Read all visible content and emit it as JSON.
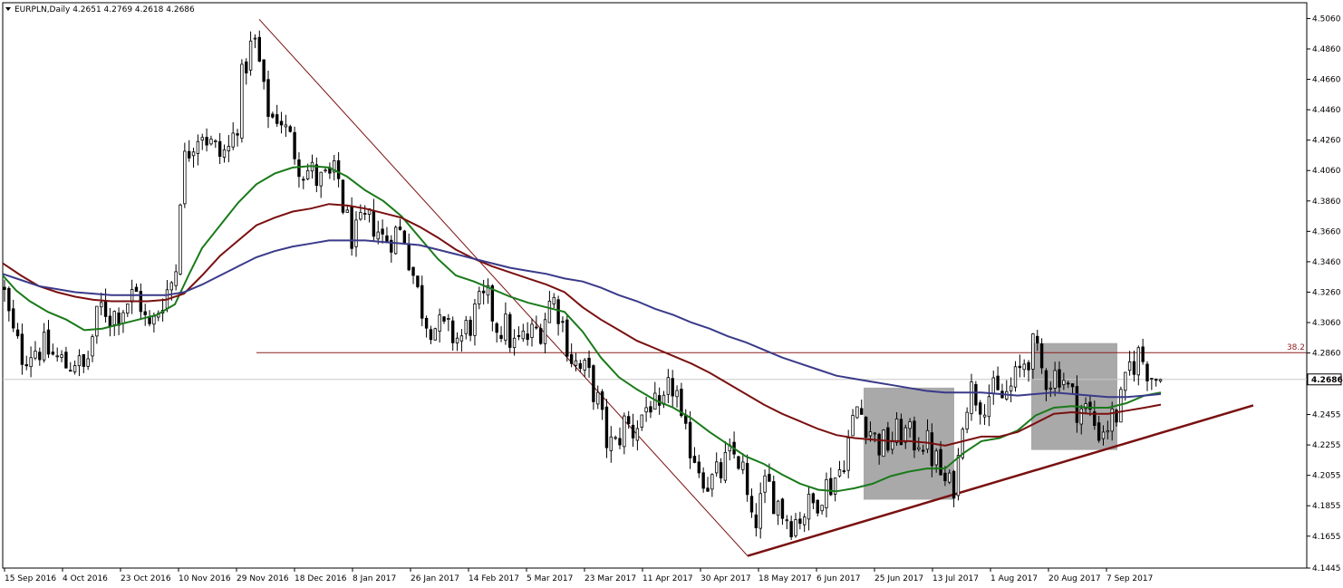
{
  "chart_data": {
    "type": "candlestick",
    "title": "EURPLN,Daily",
    "ohlc": {
      "open": "4.2651",
      "high": "4.2769",
      "low": "4.2618",
      "close": "4.2686"
    },
    "current_price_label": "4.2686",
    "current_price": 4.2686,
    "ylim": [
      4.1445,
      4.5164
    ],
    "y_ticks": [
      "4.5060",
      "4.4860",
      "4.4660",
      "4.4460",
      "4.4260",
      "4.4060",
      "4.3860",
      "4.3660",
      "4.3460",
      "4.3260",
      "4.3060",
      "4.2860",
      "4.2455",
      "4.2255",
      "4.2055",
      "4.1855",
      "4.1655",
      "4.1445"
    ],
    "x_labels": [
      "15 Sep 2016",
      "4 Oct 2016",
      "23 Oct 2016",
      "10 Nov 2016",
      "29 Nov 2016",
      "18 Dec 2016",
      "8 Jan 2017",
      "26 Jan 2017",
      "14 Feb 2017",
      "5 Mar 2017",
      "23 Mar 2017",
      "11 Apr 2017",
      "30 Apr 2017",
      "18 May 2017",
      "6 Jun 2017",
      "25 Jun 2017",
      "13 Jul 2017",
      "1 Aug 2017",
      "20 Aug 2017",
      "7 Sep 2017"
    ],
    "price_path": [
      [
        0,
        4.33
      ],
      [
        10,
        4.3
      ],
      [
        20,
        4.285
      ],
      [
        30,
        4.288
      ],
      [
        40,
        4.29
      ],
      [
        50,
        4.287
      ],
      [
        60,
        4.282
      ],
      [
        70,
        4.278
      ],
      [
        80,
        4.283
      ],
      [
        88,
        4.272
      ],
      [
        95,
        4.285
      ],
      [
        100,
        4.3
      ],
      [
        110,
        4.318
      ],
      [
        120,
        4.31
      ],
      [
        130,
        4.315
      ],
      [
        140,
        4.322
      ],
      [
        150,
        4.325
      ],
      [
        160,
        4.3
      ],
      [
        165,
        4.302
      ],
      [
        175,
        4.322
      ],
      [
        185,
        4.33
      ],
      [
        192,
        4.345
      ],
      [
        197,
        4.405
      ],
      [
        205,
        4.42
      ],
      [
        212,
        4.43
      ],
      [
        220,
        4.434
      ],
      [
        230,
        4.422
      ],
      [
        240,
        4.416
      ],
      [
        250,
        4.42
      ],
      [
        258,
        4.435
      ],
      [
        265,
        4.47
      ],
      [
        272,
        4.485
      ],
      [
        280,
        4.49
      ],
      [
        288,
        4.455
      ],
      [
        297,
        4.44
      ],
      [
        305,
        4.445
      ],
      [
        313,
        4.43
      ],
      [
        322,
        4.42
      ],
      [
        330,
        4.408
      ],
      [
        340,
        4.405
      ],
      [
        350,
        4.398
      ],
      [
        360,
        4.4
      ],
      [
        370,
        4.402
      ],
      [
        378,
        4.375
      ],
      [
        388,
        4.36
      ],
      [
        398,
        4.37
      ],
      [
        410,
        4.372
      ],
      [
        420,
        4.36
      ],
      [
        432,
        4.365
      ],
      [
        443,
        4.365
      ],
      [
        450,
        4.345
      ],
      [
        458,
        4.325
      ],
      [
        466,
        4.31
      ],
      [
        475,
        4.305
      ],
      [
        485,
        4.3
      ],
      [
        495,
        4.298
      ],
      [
        505,
        4.295
      ],
      [
        515,
        4.305
      ],
      [
        525,
        4.315
      ],
      [
        535,
        4.32
      ],
      [
        545,
        4.305
      ],
      [
        555,
        4.302
      ],
      [
        565,
        4.29
      ],
      [
        575,
        4.295
      ],
      [
        585,
        4.298
      ],
      [
        595,
        4.305
      ],
      [
        605,
        4.322
      ],
      [
        612,
        4.318
      ],
      [
        620,
        4.3
      ],
      [
        628,
        4.283
      ],
      [
        636,
        4.275
      ],
      [
        645,
        4.272
      ],
      [
        655,
        4.258
      ],
      [
        665,
        4.23
      ],
      [
        675,
        4.222
      ],
      [
        685,
        4.24
      ],
      [
        695,
        4.235
      ],
      [
        705,
        4.245
      ],
      [
        715,
        4.255
      ],
      [
        725,
        4.24
      ],
      [
        735,
        4.26
      ],
      [
        742,
        4.268
      ],
      [
        750,
        4.23
      ],
      [
        760,
        4.225
      ],
      [
        770,
        4.21
      ],
      [
        780,
        4.2
      ],
      [
        790,
        4.205
      ],
      [
        800,
        4.215
      ],
      [
        810,
        4.22
      ],
      [
        818,
        4.205
      ],
      [
        826,
        4.17
      ],
      [
        833,
        4.18
      ],
      [
        843,
        4.2
      ],
      [
        853,
        4.19
      ],
      [
        863,
        4.18
      ],
      [
        873,
        4.175
      ],
      [
        883,
        4.182
      ],
      [
        893,
        4.185
      ],
      [
        903,
        4.196
      ],
      [
        913,
        4.2
      ],
      [
        923,
        4.208
      ],
      [
        933,
        4.228
      ],
      [
        943,
        4.25
      ],
      [
        953,
        4.242
      ],
      [
        963,
        4.228
      ],
      [
        973,
        4.225
      ],
      [
        983,
        4.23
      ],
      [
        993,
        4.235
      ],
      [
        1003,
        4.228
      ],
      [
        1013,
        4.232
      ],
      [
        1023,
        4.222
      ],
      [
        1033,
        4.21
      ],
      [
        1043,
        4.195
      ],
      [
        1053,
        4.205
      ],
      [
        1060,
        4.252
      ],
      [
        1070,
        4.262
      ],
      [
        1080,
        4.255
      ],
      [
        1090,
        4.26
      ],
      [
        1100,
        4.255
      ],
      [
        1110,
        4.26
      ],
      [
        1120,
        4.27
      ],
      [
        1130,
        4.285
      ],
      [
        1138,
        4.288
      ],
      [
        1148,
        4.272
      ],
      [
        1158,
        4.27
      ],
      [
        1168,
        4.275
      ],
      [
        1178,
        4.258
      ],
      [
        1188,
        4.25
      ],
      [
        1198,
        4.248
      ],
      [
        1208,
        4.235
      ],
      [
        1218,
        4.238
      ],
      [
        1228,
        4.245
      ],
      [
        1236,
        4.255
      ],
      [
        1244,
        4.278
      ],
      [
        1254,
        4.285
      ],
      [
        1262,
        4.278
      ],
      [
        1270,
        4.27
      ],
      [
        1278,
        4.2686
      ]
    ],
    "series": [
      {
        "color": "#1a7a1a",
        "values": [
          [
            0,
            4.337
          ],
          [
            15,
            4.327
          ],
          [
            30,
            4.32
          ],
          [
            50,
            4.313
          ],
          [
            70,
            4.308
          ],
          [
            90,
            4.301
          ],
          [
            110,
            4.302
          ],
          [
            130,
            4.305
          ],
          [
            150,
            4.308
          ],
          [
            170,
            4.311
          ],
          [
            190,
            4.318
          ],
          [
            205,
            4.337
          ],
          [
            220,
            4.355
          ],
          [
            240,
            4.37
          ],
          [
            260,
            4.385
          ],
          [
            280,
            4.397
          ],
          [
            300,
            4.404
          ],
          [
            320,
            4.408
          ],
          [
            340,
            4.409
          ],
          [
            360,
            4.408
          ],
          [
            380,
            4.402
          ],
          [
            400,
            4.393
          ],
          [
            420,
            4.386
          ],
          [
            440,
            4.376
          ],
          [
            460,
            4.362
          ],
          [
            480,
            4.348
          ],
          [
            500,
            4.337
          ],
          [
            520,
            4.333
          ],
          [
            540,
            4.328
          ],
          [
            560,
            4.323
          ],
          [
            580,
            4.319
          ],
          [
            600,
            4.316
          ],
          [
            620,
            4.313
          ],
          [
            640,
            4.3
          ],
          [
            660,
            4.283
          ],
          [
            680,
            4.27
          ],
          [
            700,
            4.262
          ],
          [
            720,
            4.255
          ],
          [
            740,
            4.25
          ],
          [
            760,
            4.243
          ],
          [
            780,
            4.234
          ],
          [
            800,
            4.226
          ],
          [
            820,
            4.218
          ],
          [
            840,
            4.213
          ],
          [
            860,
            4.206
          ],
          [
            880,
            4.2
          ],
          [
            900,
            4.196
          ],
          [
            920,
            4.195
          ],
          [
            940,
            4.197
          ],
          [
            960,
            4.2
          ],
          [
            980,
            4.205
          ],
          [
            1000,
            4.208
          ],
          [
            1020,
            4.21
          ],
          [
            1040,
            4.21
          ],
          [
            1060,
            4.22
          ],
          [
            1080,
            4.228
          ],
          [
            1100,
            4.23
          ],
          [
            1120,
            4.235
          ],
          [
            1140,
            4.245
          ],
          [
            1160,
            4.25
          ],
          [
            1180,
            4.251
          ],
          [
            1200,
            4.25
          ],
          [
            1220,
            4.25
          ],
          [
            1240,
            4.253
          ],
          [
            1260,
            4.258
          ],
          [
            1278,
            4.26
          ]
        ]
      },
      {
        "color": "#7a1010",
        "values": [
          [
            0,
            4.345
          ],
          [
            20,
            4.337
          ],
          [
            40,
            4.33
          ],
          [
            60,
            4.326
          ],
          [
            80,
            4.323
          ],
          [
            100,
            4.321
          ],
          [
            120,
            4.32
          ],
          [
            140,
            4.32
          ],
          [
            160,
            4.32
          ],
          [
            180,
            4.321
          ],
          [
            200,
            4.325
          ],
          [
            220,
            4.337
          ],
          [
            240,
            4.35
          ],
          [
            260,
            4.36
          ],
          [
            280,
            4.37
          ],
          [
            300,
            4.375
          ],
          [
            320,
            4.379
          ],
          [
            340,
            4.381
          ],
          [
            360,
            4.384
          ],
          [
            380,
            4.383
          ],
          [
            400,
            4.381
          ],
          [
            420,
            4.378
          ],
          [
            440,
            4.375
          ],
          [
            460,
            4.369
          ],
          [
            480,
            4.362
          ],
          [
            500,
            4.354
          ],
          [
            520,
            4.348
          ],
          [
            540,
            4.343
          ],
          [
            560,
            4.339
          ],
          [
            580,
            4.335
          ],
          [
            600,
            4.331
          ],
          [
            620,
            4.326
          ],
          [
            640,
            4.316
          ],
          [
            660,
            4.308
          ],
          [
            680,
            4.301
          ],
          [
            700,
            4.294
          ],
          [
            720,
            4.289
          ],
          [
            740,
            4.284
          ],
          [
            760,
            4.279
          ],
          [
            780,
            4.273
          ],
          [
            800,
            4.266
          ],
          [
            820,
            4.259
          ],
          [
            840,
            4.252
          ],
          [
            860,
            4.246
          ],
          [
            880,
            4.241
          ],
          [
            900,
            4.236
          ],
          [
            920,
            4.232
          ],
          [
            940,
            4.23
          ],
          [
            960,
            4.229
          ],
          [
            980,
            4.228
          ],
          [
            1000,
            4.228
          ],
          [
            1020,
            4.227
          ],
          [
            1040,
            4.225
          ],
          [
            1060,
            4.228
          ],
          [
            1080,
            4.231
          ],
          [
            1100,
            4.231
          ],
          [
            1120,
            4.234
          ],
          [
            1140,
            4.24
          ],
          [
            1160,
            4.246
          ],
          [
            1180,
            4.247
          ],
          [
            1200,
            4.246
          ],
          [
            1220,
            4.246
          ],
          [
            1240,
            4.248
          ],
          [
            1260,
            4.25
          ],
          [
            1278,
            4.252
          ]
        ]
      },
      {
        "color": "#3a3a8a",
        "values": [
          [
            0,
            4.338
          ],
          [
            20,
            4.334
          ],
          [
            40,
            4.33
          ],
          [
            60,
            4.328
          ],
          [
            80,
            4.326
          ],
          [
            100,
            4.325
          ],
          [
            120,
            4.324
          ],
          [
            140,
            4.324
          ],
          [
            160,
            4.324
          ],
          [
            180,
            4.324
          ],
          [
            200,
            4.326
          ],
          [
            220,
            4.331
          ],
          [
            240,
            4.337
          ],
          [
            260,
            4.343
          ],
          [
            280,
            4.349
          ],
          [
            300,
            4.353
          ],
          [
            320,
            4.356
          ],
          [
            340,
            4.358
          ],
          [
            360,
            4.36
          ],
          [
            380,
            4.36
          ],
          [
            400,
            4.36
          ],
          [
            420,
            4.359
          ],
          [
            440,
            4.358
          ],
          [
            460,
            4.357
          ],
          [
            480,
            4.354
          ],
          [
            500,
            4.351
          ],
          [
            520,
            4.348
          ],
          [
            540,
            4.345
          ],
          [
            560,
            4.342
          ],
          [
            580,
            4.34
          ],
          [
            600,
            4.338
          ],
          [
            620,
            4.335
          ],
          [
            640,
            4.333
          ],
          [
            660,
            4.329
          ],
          [
            680,
            4.324
          ],
          [
            700,
            4.32
          ],
          [
            720,
            4.315
          ],
          [
            740,
            4.311
          ],
          [
            760,
            4.306
          ],
          [
            780,
            4.302
          ],
          [
            800,
            4.297
          ],
          [
            820,
            4.293
          ],
          [
            840,
            4.288
          ],
          [
            860,
            4.283
          ],
          [
            880,
            4.279
          ],
          [
            900,
            4.275
          ],
          [
            920,
            4.271
          ],
          [
            940,
            4.269
          ],
          [
            960,
            4.267
          ],
          [
            980,
            4.265
          ],
          [
            1000,
            4.263
          ],
          [
            1020,
            4.261
          ],
          [
            1040,
            4.26
          ],
          [
            1060,
            4.26
          ],
          [
            1080,
            4.26
          ],
          [
            1100,
            4.259
          ],
          [
            1120,
            4.258
          ],
          [
            1140,
            4.259
          ],
          [
            1160,
            4.26
          ],
          [
            1180,
            4.259
          ],
          [
            1200,
            4.258
          ],
          [
            1220,
            4.257
          ],
          [
            1240,
            4.257
          ],
          [
            1260,
            4.258
          ],
          [
            1278,
            4.259
          ]
        ]
      }
    ],
    "fib_label": "38.2",
    "fib_level": 4.2862,
    "fib_color": "#8b2020",
    "shaded_boxes": [
      {
        "x0": 950,
        "x1": 1050,
        "y_top": 4.2632,
        "y_bottom": 4.1895
      },
      {
        "x0": 1135,
        "x1": 1230,
        "y_top": 4.2925,
        "y_bottom": 4.2222
      }
    ],
    "trendlines": [
      {
        "x1": 283,
        "y1": 4.5055,
        "x2": 822,
        "y2": 4.1525,
        "color": "#7a1010"
      },
      {
        "x1": 822,
        "y1": 4.1525,
        "x2": 1380,
        "y2": 4.2515,
        "color": "#7a1010"
      }
    ]
  }
}
